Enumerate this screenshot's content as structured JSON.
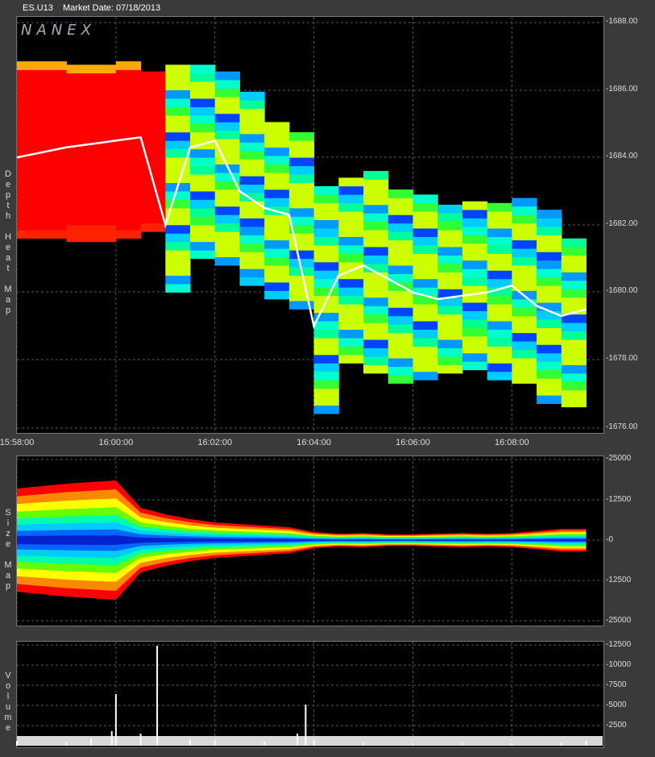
{
  "header": {
    "symbol": "ES.U13",
    "market_date": "Market Date: 07/18/2013",
    "logo": "NANEX"
  },
  "panels": [
    {
      "id": "depth",
      "label_letters": [
        "D",
        "e",
        "p",
        "t",
        "h",
        "",
        "H",
        "e",
        "a",
        "t",
        "",
        "M",
        "a",
        "p"
      ],
      "y_ticks": [
        "-1688.00",
        "-1686.00",
        "-1684.00",
        "-1682.00",
        "-1680.00",
        "-1678.00",
        "-1676.00"
      ]
    },
    {
      "id": "size",
      "label_letters": [
        "S",
        "i",
        "z",
        "e",
        "",
        "M",
        "a",
        "p"
      ],
      "y_ticks": [
        "-25000",
        "-12500",
        "-0",
        "-12500",
        "-25000"
      ]
    },
    {
      "id": "volume",
      "label_letters": [
        "V",
        "o",
        "l",
        "u",
        "m",
        "e"
      ],
      "y_ticks": [
        "-12500",
        "-10000",
        "-7500",
        "-5000",
        "-2500"
      ]
    }
  ],
  "x_ticks": [
    "15:58:00",
    "16:00:00",
    "16:02:00",
    "16:04:00",
    "16:06:00",
    "16:08:00"
  ],
  "colors": {
    "high": "#ff0000",
    "mid": "#ffff00",
    "low": "#00ff88",
    "deep": "#0033ff",
    "price": "#ffffff"
  },
  "chart_data": [
    {
      "type": "heatmap",
      "title": "Depth Heat Map",
      "ylabel": "",
      "ylim": [
        1676,
        1688
      ],
      "x": [
        "15:58:00",
        "15:59:00",
        "16:00:00",
        "16:00:30",
        "16:01:00",
        "16:01:30",
        "16:02:00",
        "16:02:30",
        "16:03:00",
        "16:03:30",
        "16:04:00",
        "16:04:30",
        "16:05:00",
        "16:05:30",
        "16:06:00",
        "16:06:30",
        "16:07:00",
        "16:07:30",
        "16:08:00",
        "16:08:30",
        "16:09:00",
        "16:09:30"
      ],
      "series": [
        {
          "name": "",
          "values": [
            1684,
            1684.3,
            1684.5,
            1684.6,
            1682,
            1684.3,
            1684.5,
            1683,
            1682.5,
            1682.3,
            1679,
            1680.5,
            1680.8,
            1680.4,
            1680,
            1679.8,
            1679.9,
            1680,
            1680.2,
            1679.6,
            1679.3,
            1679.5
          ]
        }
      ],
      "bands_top": [
        1686.7,
        1686.7,
        1686.7,
        1686.5,
        1686.6,
        1686.7,
        1686.5,
        1685.8,
        1685,
        1684.7,
        1683,
        1683.3,
        1683.5,
        1683,
        1682.8,
        1682.5,
        1682.7,
        1682.5,
        1682.6,
        1682.3,
        1681.5,
        1681.5
      ],
      "bands_bottom": [
        1681.6,
        1681.5,
        1681.6,
        1681.8,
        1680,
        1681,
        1680.8,
        1680.2,
        1679.8,
        1679.5,
        1676.4,
        1677.9,
        1677.6,
        1677.3,
        1677.4,
        1677.6,
        1677.7,
        1677.4,
        1677.3,
        1676.7,
        1676.6,
        1676.5
      ]
    },
    {
      "type": "area",
      "title": "Size Map",
      "ylim": [
        -25000,
        25000
      ],
      "x": [
        "15:58:00",
        "15:59:00",
        "16:00:00",
        "16:00:30",
        "16:01:00",
        "16:01:30",
        "16:02:00",
        "16:02:30",
        "16:03:00",
        "16:03:30",
        "16:04:00",
        "16:04:30",
        "16:05:00",
        "16:05:30",
        "16:06:00",
        "16:06:30",
        "16:07:00",
        "16:07:30",
        "16:08:00",
        "16:08:30",
        "16:09:00",
        "16:09:30"
      ],
      "values": [
        16000,
        17500,
        18500,
        10000,
        8000,
        6500,
        5500,
        5000,
        4500,
        4000,
        2500,
        2000,
        2200,
        1800,
        1800,
        2000,
        2200,
        2000,
        2200,
        2800,
        3500,
        3500
      ]
    },
    {
      "type": "bar",
      "title": "Volume",
      "ylim": [
        0,
        12500
      ],
      "x": [
        "15:58:00",
        "15:59:00",
        "15:59:30",
        "15:59:55",
        "16:00:00",
        "16:00:30",
        "16:00:50",
        "16:01:30",
        "16:02:00",
        "16:03:00",
        "16:03:40",
        "16:03:50",
        "16:04:00",
        "16:05:00",
        "16:06:00",
        "16:07:00",
        "16:08:00",
        "16:09:00",
        "16:09:30"
      ],
      "values": [
        600,
        400,
        900,
        1800,
        6400,
        1500,
        12400,
        800,
        600,
        500,
        1500,
        5100,
        700,
        400,
        300,
        350,
        300,
        400,
        600
      ]
    }
  ]
}
